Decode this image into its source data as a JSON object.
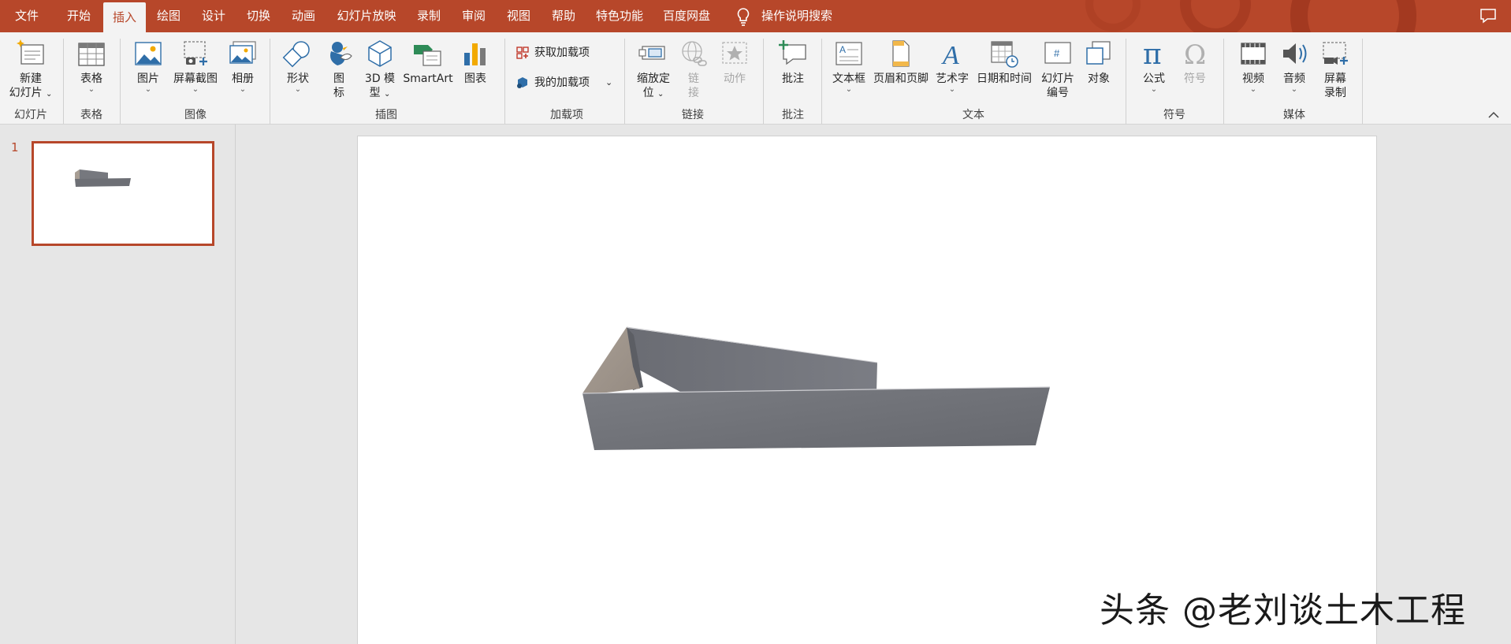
{
  "menu": {
    "tabs": [
      {
        "label": "文件"
      },
      {
        "label": "开始"
      },
      {
        "label": "插入"
      },
      {
        "label": "绘图"
      },
      {
        "label": "设计"
      },
      {
        "label": "切换"
      },
      {
        "label": "动画"
      },
      {
        "label": "幻灯片放映"
      },
      {
        "label": "录制"
      },
      {
        "label": "审阅"
      },
      {
        "label": "视图"
      },
      {
        "label": "帮助"
      },
      {
        "label": "特色功能"
      },
      {
        "label": "百度网盘"
      }
    ],
    "active_tab": "插入",
    "search_label": "操作说明搜索"
  },
  "ribbon": {
    "new_slide": {
      "line1": "新建",
      "line2": "幻灯片"
    },
    "table": {
      "label": "表格"
    },
    "picture": {
      "label": "图片"
    },
    "screenshot": {
      "label": "屏幕截图"
    },
    "album": {
      "label": "相册"
    },
    "shapes": {
      "label": "形状"
    },
    "icons": {
      "line1": "图",
      "line2": "标"
    },
    "model3d": {
      "line1": "3D 模",
      "line2": "型"
    },
    "smartart": {
      "label": "SmartArt"
    },
    "chart": {
      "label": "图表"
    },
    "get_addins": {
      "label": "获取加载项"
    },
    "my_addins": {
      "label": "我的加载项"
    },
    "zoom": {
      "line1": "缩放定",
      "line2": "位"
    },
    "link": {
      "line1": "链",
      "line2": "接"
    },
    "action": {
      "label": "动作"
    },
    "comment": {
      "label": "批注"
    },
    "textbox": {
      "label": "文本框"
    },
    "header_footer": {
      "label": "页眉和页脚"
    },
    "wordart": {
      "label": "艺术字"
    },
    "datetime": {
      "label": "日期和时间"
    },
    "slide_number": {
      "line1": "幻灯片",
      "line2": "编号"
    },
    "object": {
      "label": "对象"
    },
    "equation": {
      "label": "公式"
    },
    "symbol": {
      "label": "符号"
    },
    "video": {
      "label": "视频"
    },
    "audio": {
      "label": "音频"
    },
    "screen_recording": {
      "line1": "屏幕",
      "line2": "录制"
    },
    "groups": {
      "slides": "幻灯片",
      "tables": "表格",
      "images": "图像",
      "illustrations": "插图",
      "addins": "加载项",
      "links": "链接",
      "comments": "批注",
      "text": "文本",
      "symbols": "符号",
      "media": "媒体"
    }
  },
  "slides_panel": {
    "slide_number": "1"
  },
  "watermark": "头条 @老刘谈土木工程",
  "colors": {
    "accent": "#b7472a",
    "ribbon_bg": "#f3f3f3",
    "panel_bg": "#e6e6e6",
    "model_gray": "#76787e",
    "model_tan": "#a89e94"
  }
}
